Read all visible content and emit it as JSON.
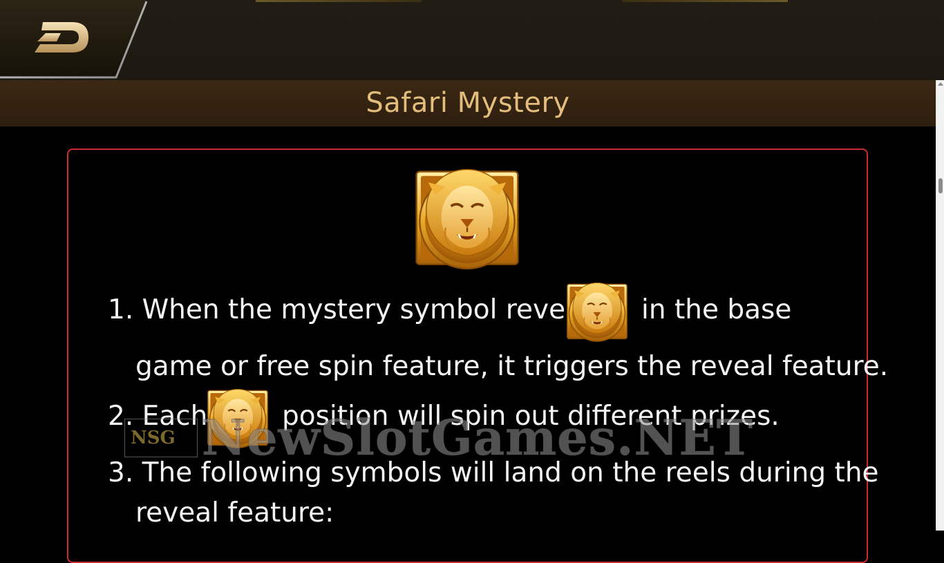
{
  "header": {
    "back_icon": "back-arrow-icon",
    "title": "Safari Mystery"
  },
  "colors": {
    "title_gold": "#e3bd7c",
    "panel_border": "#d02b2b",
    "text": "#f4f4f4"
  },
  "feature": {
    "icon": "lion-mystery-symbol-icon",
    "lines": {
      "l1a": "1. When the mystery symbol reveals",
      "l1b": "in the base",
      "l1c": "game or free spin feature, it triggers the reveal feature.",
      "l2a": "2. Each",
      "l2b": "position will spin out different prizes.",
      "l3a": "3. The following symbols will land on the reels during the",
      "l3b": "reveal feature:"
    }
  },
  "watermark": {
    "text": "NewSlotGames.NET",
    "logo_letters": "NSG"
  }
}
